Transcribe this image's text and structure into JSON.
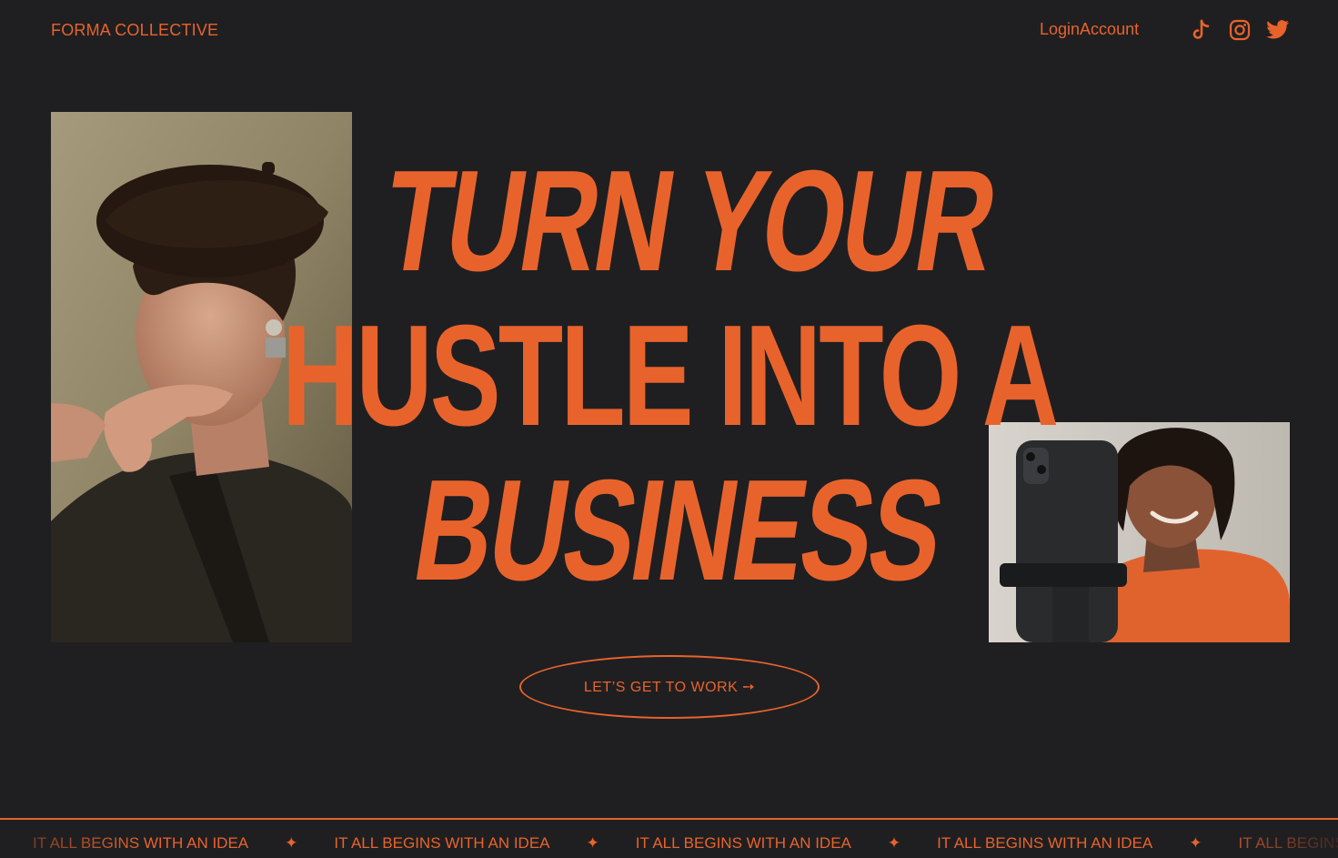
{
  "header": {
    "brand": "FORMA COLLECTIVE",
    "login_label": "Login",
    "account_label": "Account",
    "social_icons": [
      "tiktok-icon",
      "instagram-icon",
      "twitter-icon"
    ]
  },
  "hero": {
    "headline_line1": "TURN YOUR",
    "headline_line2": "HUSTLE INTO A",
    "headline_line3": "BUSINESS",
    "cta_label": "LET’S GET TO WORK ➙",
    "left_photo_alt": "Person in beret with hand near chin",
    "right_photo_alt": "Smiling man behind phone on tripod"
  },
  "ticker": {
    "items": [
      "IT ALL BEGINS WITH AN IDEA",
      "IT ALL BEGINS WITH AN IDEA",
      "IT ALL BEGINS WITH AN IDEA",
      "IT ALL BEGINS WITH AN IDEA",
      "IT ALL BEGINS WITH AN IDEA"
    ],
    "separator": "✦"
  },
  "colors": {
    "background": "#1f1f21",
    "accent": "#e8632c"
  }
}
